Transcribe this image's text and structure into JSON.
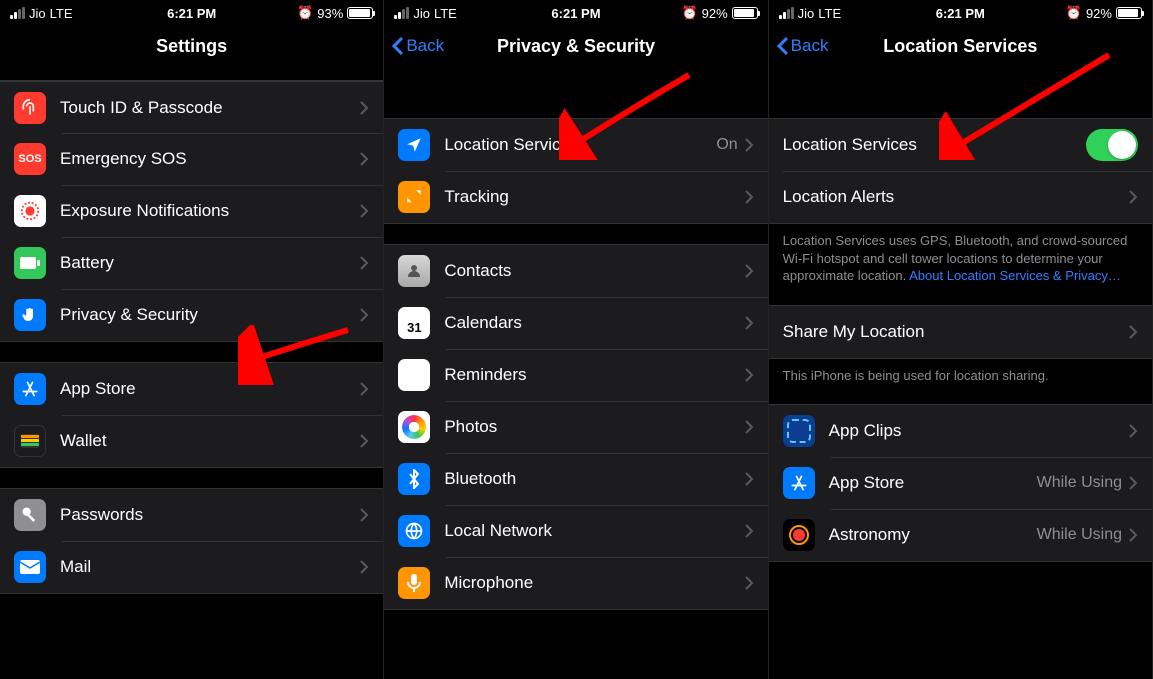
{
  "status": {
    "carrier": "Jio",
    "network": "LTE",
    "time": "6:21 PM",
    "battery1": "93%",
    "battery2": "92%",
    "battery3": "92%"
  },
  "screen1": {
    "title": "Settings",
    "rows": {
      "touchid": "Touch ID & Passcode",
      "sos": "Emergency SOS",
      "exposure": "Exposure Notifications",
      "battery": "Battery",
      "privacy": "Privacy & Security",
      "appstore": "App Store",
      "wallet": "Wallet",
      "passwords": "Passwords",
      "mail": "Mail"
    }
  },
  "screen2": {
    "back": "Back",
    "title": "Privacy & Security",
    "location_row": "Location Services",
    "location_value": "On",
    "tracking": "Tracking",
    "contacts": "Contacts",
    "calendars": "Calendars",
    "reminders": "Reminders",
    "photos": "Photos",
    "bluetooth": "Bluetooth",
    "localnet": "Local Network",
    "microphone": "Microphone"
  },
  "screen3": {
    "back": "Back",
    "title": "Location Services",
    "toggle_label": "Location Services",
    "alerts_label": "Location Alerts",
    "description": "Location Services uses GPS, Bluetooth, and crowd-sourced Wi-Fi hotspot and cell tower locations to determine your approximate location. ",
    "description_link": "About Location Services & Privacy…",
    "share_label": "Share My Location",
    "share_footer": "This iPhone is being used for location sharing.",
    "apps": {
      "appclips": {
        "label": "App Clips",
        "value": ""
      },
      "appstore": {
        "label": "App Store",
        "value": "While Using"
      },
      "astronomy": {
        "label": "Astronomy",
        "value": "While Using"
      }
    }
  }
}
